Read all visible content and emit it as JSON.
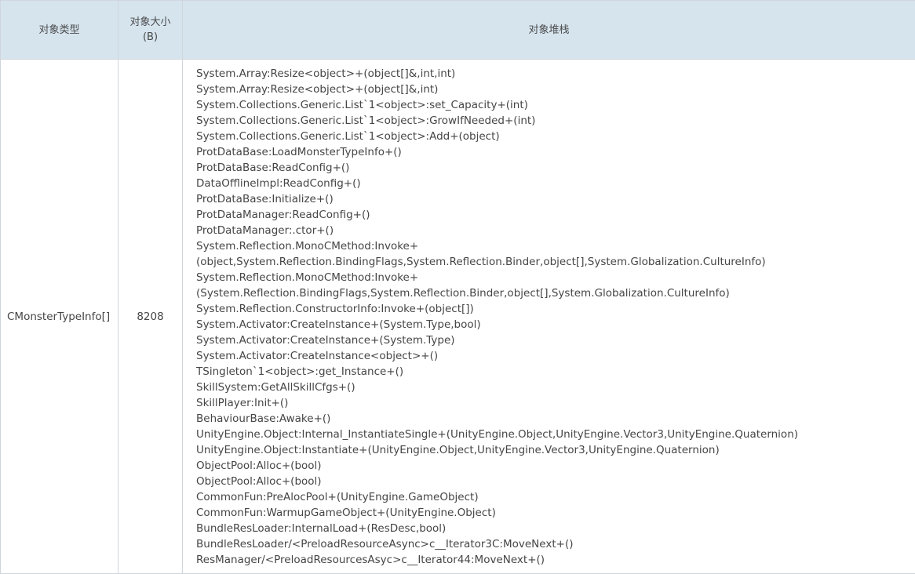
{
  "columns": {
    "type": "对象类型",
    "size_line1": "对象大小",
    "size_line2": "(B)",
    "stack": "对象堆栈"
  },
  "row": {
    "type": "CMonsterTypeInfo[]",
    "size": "8208",
    "stack": [
      "System.Array:Resize<object>+(object[]&,int,int)",
      "System.Array:Resize<object>+(object[]&,int)",
      "System.Collections.Generic.List`1<object>:set_Capacity+(int)",
      "System.Collections.Generic.List`1<object>:GrowIfNeeded+(int)",
      "System.Collections.Generic.List`1<object>:Add+(object)",
      "ProtDataBase:LoadMonsterTypeInfo+()",
      "ProtDataBase:ReadConfig+()",
      "DataOfflineImpl:ReadConfig+()",
      "ProtDataBase:Initialize+()",
      "ProtDataManager:ReadConfig+()",
      "ProtDataManager:.ctor+()",
      "System.Reflection.MonoCMethod:Invoke+",
      "(object,System.Reflection.BindingFlags,System.Reflection.Binder,object[],System.Globalization.CultureInfo)",
      "System.Reflection.MonoCMethod:Invoke+",
      "(System.Reflection.BindingFlags,System.Reflection.Binder,object[],System.Globalization.CultureInfo)",
      "System.Reflection.ConstructorInfo:Invoke+(object[])",
      "System.Activator:CreateInstance+(System.Type,bool)",
      "System.Activator:CreateInstance+(System.Type)",
      "System.Activator:CreateInstance<object>+()",
      "TSingleton`1<object>:get_Instance+()",
      "SkillSystem:GetAllSkillCfgs+()",
      "SkillPlayer:Init+()",
      "BehaviourBase:Awake+()",
      "UnityEngine.Object:Internal_InstantiateSingle+(UnityEngine.Object,UnityEngine.Vector3,UnityEngine.Quaternion)",
      "UnityEngine.Object:Instantiate+(UnityEngine.Object,UnityEngine.Vector3,UnityEngine.Quaternion)",
      "ObjectPool:Alloc+(bool)",
      "ObjectPool:Alloc+(bool)",
      "CommonFun:PreAlocPool+(UnityEngine.GameObject)",
      "CommonFun:WarmupGameObject+(UnityEngine.Object)",
      "BundleResLoader:InternalLoad+(ResDesc,bool)",
      "BundleResLoader/<PreloadResourceAsync>c__Iterator3C:MoveNext+()",
      "ResManager/<PreloadResourcesAsyc>c__Iterator44:MoveNext+()"
    ]
  }
}
